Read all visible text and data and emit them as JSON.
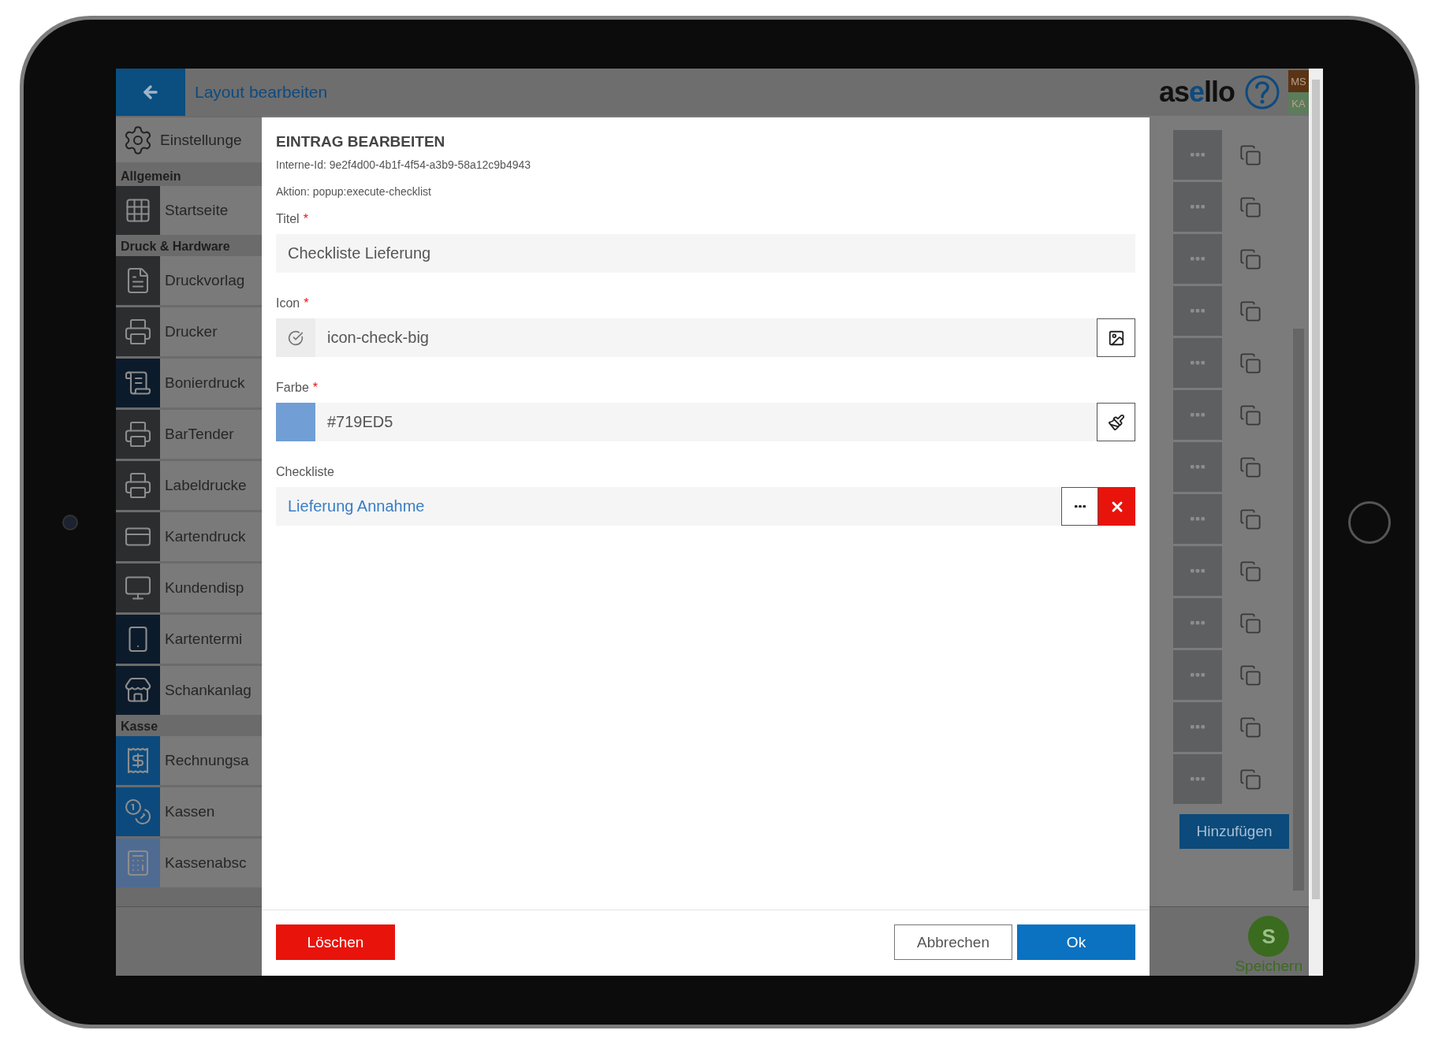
{
  "header": {
    "title": "Layout bearbeiten",
    "logo": [
      "as",
      "e",
      "llo"
    ],
    "users": [
      {
        "initials": "MS",
        "color": "#5a3415"
      },
      {
        "initials": "KA",
        "color": "#5b7d5b"
      }
    ]
  },
  "sidebar": {
    "top_item": {
      "label": "Einstellunge"
    },
    "sections": [
      {
        "title": "Allgemein",
        "items": [
          {
            "label": "Startseite",
            "color": "#2b2d2f"
          }
        ]
      },
      {
        "title": "Druck & Hardware",
        "items": [
          {
            "label": "Druckvorlag",
            "color": "#2b2d2f"
          },
          {
            "label": "Drucker",
            "color": "#2b2d2f"
          },
          {
            "label": "Bonierdruck",
            "color": "#0c1b2b"
          },
          {
            "label": "BarTender",
            "color": "#2b2d2f"
          },
          {
            "label": "Labeldrucke",
            "color": "#2b2d2f"
          },
          {
            "label": "Kartendruck",
            "color": "#2b2d2f"
          },
          {
            "label": "Kundendisp",
            "color": "#2b2d2f"
          },
          {
            "label": "Kartentermi",
            "color": "#0c1b2b"
          },
          {
            "label": "Schankanlag",
            "color": "#0c1b2b"
          }
        ]
      },
      {
        "title": "Kasse",
        "items": [
          {
            "label": "Rechnungsa",
            "color": "#0c4a7d"
          },
          {
            "label": "Kassen",
            "color": "#0c4a7d"
          },
          {
            "label": "Kassenabsc",
            "color": "#4f6b92"
          }
        ]
      }
    ]
  },
  "right_panel": {
    "add_button": "Hinzufügen"
  },
  "bottom_bar": {
    "save_initial": "S",
    "save_label": "Speichern"
  },
  "dialog": {
    "title": "EINTRAG BEARBEITEN",
    "meta": [
      "Interne-Id: 9e2f4d00-4b1f-4f54-a3b9-58a12c9b4943",
      "Aktion: popup:execute-checklist"
    ],
    "fields": [
      {
        "kind": "text",
        "label": "Titel",
        "required_mark": "*",
        "value": "Checkliste Lieferung"
      },
      {
        "kind": "icon",
        "label": "Icon",
        "required_mark": "*",
        "value": "icon-check-big"
      },
      {
        "kind": "color",
        "label": "Farbe",
        "required_mark": "*",
        "value": "#719ED5",
        "color": "#719ed5"
      },
      {
        "kind": "link",
        "label": "Checkliste",
        "value": "Lieferung Annahme"
      }
    ],
    "buttons": [
      {
        "kind": "danger",
        "label": "Löschen"
      },
      {
        "kind": "secondary",
        "label": "Abbrechen"
      },
      {
        "kind": "primary",
        "label": "Ok"
      }
    ]
  }
}
